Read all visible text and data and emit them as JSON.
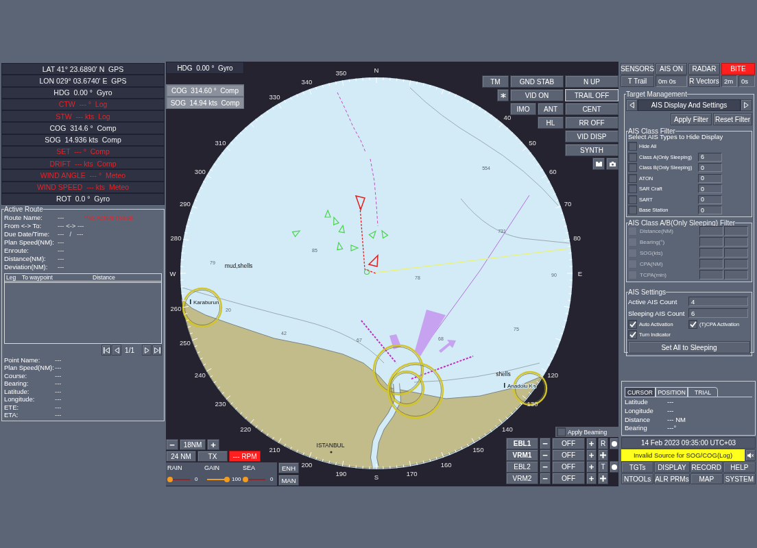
{
  "nav_data": [
    {
      "text": "LAT 41° 23.6890' N  GPS",
      "invalid": false
    },
    {
      "text": "LON 029° 03.6740' E  GPS",
      "invalid": false
    },
    {
      "text": "HDG  0.00 °  Gyro",
      "invalid": false
    },
    {
      "text": "CTW  --- °  Log",
      "invalid": true
    },
    {
      "text": "STW  --- kts  Log",
      "invalid": true
    },
    {
      "text": "COG  314.6 °  Comp",
      "invalid": false
    },
    {
      "text": "SOG  14.936 kts  Comp",
      "invalid": false
    },
    {
      "text": "SET  --- °  Comp",
      "invalid": true
    },
    {
      "text": "DRIFT  --- kts  Comp",
      "invalid": true
    },
    {
      "text": "WIND ANGLE  --- °  Meteo",
      "invalid": true
    },
    {
      "text": "WIND SPEED  --- kts  Meteo",
      "invalid": true
    },
    {
      "text": "ROT  0.0 °  Gyro",
      "invalid": false
    }
  ],
  "active_route": {
    "title": "Active Route",
    "info_rows": [
      [
        "Route Name:",
        "---",
        "*No Active Route"
      ],
      [
        "From <-> To:",
        "--- <-> ---"
      ],
      [
        "Due Date/Time:",
        "---   /   ---"
      ],
      [
        "Plan Speed(NM):",
        "---"
      ],
      [
        "Enroute:",
        "---"
      ],
      [
        "Distance(NM):",
        "---"
      ],
      [
        "Deviation(NM):",
        "---"
      ]
    ],
    "columns": [
      "Leg",
      "To waypoint",
      "Distance"
    ],
    "page": "1/1",
    "point_rows": [
      [
        "Point Name:",
        "---"
      ],
      [
        "Plan Speed(NM):",
        "---"
      ],
      [
        "Course:",
        "---"
      ],
      [
        "Bearing:",
        "---"
      ],
      [
        "Latitude:",
        "---"
      ],
      [
        "Longitude:",
        "---"
      ],
      [
        "ETE:",
        "---"
      ],
      [
        "ETA:",
        "---"
      ]
    ]
  },
  "radar": {
    "heading_box": [
      {
        "text": "HDG  0.00 °  Gyro",
        "kind": "readout"
      },
      {
        "text": "COG  314.60 °  Comp",
        "kind": "button"
      },
      {
        "text": "SOG  14.94 kts  Comp",
        "kind": "button"
      }
    ],
    "bearing_labels_west": [
      "350",
      "340",
      "330",
      "310",
      "300",
      "290",
      "280",
      "W",
      "260",
      "250",
      "240",
      "230",
      "220",
      "210",
      "200",
      "190"
    ],
    "bearing_labels_east": [
      "N",
      "40",
      "50",
      "60",
      "70",
      "80",
      "E",
      "120",
      "130",
      "140",
      "150",
      "160",
      "170",
      "S"
    ],
    "chart_labels": [
      {
        "text": "554",
        "kind": "depth"
      },
      {
        "text": "731",
        "kind": "depth"
      },
      {
        "text": "85",
        "kind": "depth"
      },
      {
        "text": "79",
        "kind": "depth"
      },
      {
        "text": "mud,shells",
        "kind": "note"
      },
      {
        "text": "78",
        "kind": "depth"
      },
      {
        "text": "90",
        "kind": "depth"
      },
      {
        "text": "Karaburun",
        "kind": "place"
      },
      {
        "text": "20",
        "kind": "depth"
      },
      {
        "text": "42",
        "kind": "depth"
      },
      {
        "text": "67",
        "kind": "depth"
      },
      {
        "text": "68",
        "kind": "depth"
      },
      {
        "text": "75",
        "kind": "depth"
      },
      {
        "text": "shells",
        "kind": "note"
      },
      {
        "text": "Anadolu Ka",
        "kind": "place"
      },
      {
        "text": "ISTANBUL",
        "kind": "city"
      }
    ],
    "display_buttons": [
      {
        "label": "TM",
        "selected": false
      },
      {
        "label": "GND STAB",
        "selected": false
      },
      {
        "label": "N UP",
        "selected": false
      },
      {
        "label": "VID ON",
        "selected": false
      },
      {
        "label": "TRAIL OFF",
        "selected": true
      },
      {
        "label": "IMO",
        "selected": false
      },
      {
        "label": "ANT",
        "selected": false
      },
      {
        "label": "CENT",
        "selected": false
      },
      {
        "label": "HL",
        "selected": false
      },
      {
        "label": "RR OFF",
        "selected": false
      },
      {
        "label": "VID DISP",
        "selected": false
      },
      {
        "label": "SYNTH",
        "selected": false
      }
    ],
    "range": {
      "minus": "−",
      "value": "18NM",
      "plus": "+"
    },
    "mode_buttons": [
      {
        "label": "24 NM",
        "alarm": false
      },
      {
        "label": "TX",
        "alarm": false
      },
      {
        "label": "--- RPM",
        "alarm": true
      }
    ],
    "sliders": [
      {
        "label": "RAIN",
        "level": 0,
        "reading": "0"
      },
      {
        "label": "GAIN",
        "level": 1,
        "reading": "100"
      },
      {
        "label": "SEA",
        "level": 0,
        "reading": "0"
      }
    ],
    "side_buttons": [
      "ENH",
      "MAN"
    ],
    "beaming": {
      "label": "Apply Beaming",
      "checked": false
    },
    "ebl_vrm": [
      {
        "kind": "ebl",
        "name": "EBL1",
        "active": true,
        "minus": "−",
        "value": "OFF",
        "plus": "+",
        "extra": "R"
      },
      {
        "kind": "vrm",
        "name": "VRM1",
        "active": true,
        "minus": "−",
        "value": "OFF",
        "plus": "+"
      },
      {
        "kind": "ebl",
        "name": "EBL2",
        "active": false,
        "minus": "−",
        "value": "OFF",
        "plus": "+",
        "extra": "T"
      },
      {
        "kind": "vrm",
        "name": "VRM2",
        "active": false,
        "minus": "−",
        "value": "OFF",
        "plus": "+"
      }
    ]
  },
  "status_tabs": [
    {
      "label": "SENSORS",
      "alarm": false
    },
    {
      "label": "AIS ON",
      "alarm": false
    },
    {
      "label": "RADAR",
      "alarm": false
    },
    {
      "label": "BITE",
      "alarm": true
    }
  ],
  "trails": {
    "trail_button": "T Trail",
    "trail_time": "0m 0s",
    "vector_button": "R Vectors",
    "vector_minutes": "2m",
    "vector_seconds": "0s"
  },
  "target_management": {
    "title": "Target Management",
    "page_title": "AIS Display And Settings",
    "filter_buttons": [
      "Apply Filter",
      "Reset Filter"
    ],
    "class_filter": {
      "title": "AIS Class Filter",
      "instruction": "Select AIS Types to Hide Display",
      "items": [
        {
          "label": "Hide All",
          "checked": false
        },
        {
          "label": "Class A(Only Sleeping)",
          "checked": false,
          "count": "6"
        },
        {
          "label": "Class B(Only Sleeping)",
          "checked": false,
          "count": "0"
        },
        {
          "label": "ATON",
          "checked": false,
          "count": "0"
        },
        {
          "label": "SAR Craft",
          "checked": false,
          "count": "0"
        },
        {
          "label": "SART",
          "checked": false,
          "count": "0"
        },
        {
          "label": "Base Station",
          "checked": false,
          "count": "0"
        }
      ]
    },
    "sleeping_filter": {
      "title": "AIS Class A/B(Only Sleeping) Filter",
      "items": [
        {
          "label": "Distance(NM)",
          "checked": false,
          "disabled": true
        },
        {
          "label": "Bearing(°)",
          "checked": false,
          "disabled": true
        },
        {
          "label": "SOG(kts)",
          "checked": false,
          "disabled": true
        },
        {
          "label": "CPA(NM)",
          "checked": false,
          "disabled": true
        },
        {
          "label": "TCPA(min)",
          "checked": false,
          "disabled": true
        }
      ]
    },
    "settings": {
      "title": "AIS Settings",
      "counts": [
        {
          "label": "Active AIS Count",
          "value": "4"
        },
        {
          "label": "Sleeping AIS Count",
          "value": "6"
        }
      ],
      "options": [
        {
          "label": "Auto Activation",
          "checked": true
        },
        {
          "label": "(T)CPA Activation",
          "checked": true
        },
        {
          "label": "Turn Indicator",
          "checked": true
        }
      ],
      "button": "Set All to Sleeping"
    }
  },
  "cursor_panel": {
    "tabs": [
      {
        "label": "CURSOR",
        "selected": true
      },
      {
        "label": "POSITION",
        "selected": false
      },
      {
        "label": "TRIAL",
        "selected": false
      }
    ],
    "rows": [
      {
        "label": "Latitude",
        "value": "---"
      },
      {
        "label": "Longitude",
        "value": "---"
      },
      {
        "label": "Distance",
        "value": "--- NM"
      },
      {
        "label": "Bearing",
        "value": "---°"
      }
    ]
  },
  "datetime": "14 Feb 2023 09:35:00 UTC+03",
  "alert": "Invalid Source for SOG/COG(Log)",
  "menu_buttons": [
    "TGTs",
    "DISPLAY",
    "RECORD",
    "HELP",
    "NTOOLs",
    "ALR PRMs",
    "MAP",
    "SYSTEM"
  ]
}
